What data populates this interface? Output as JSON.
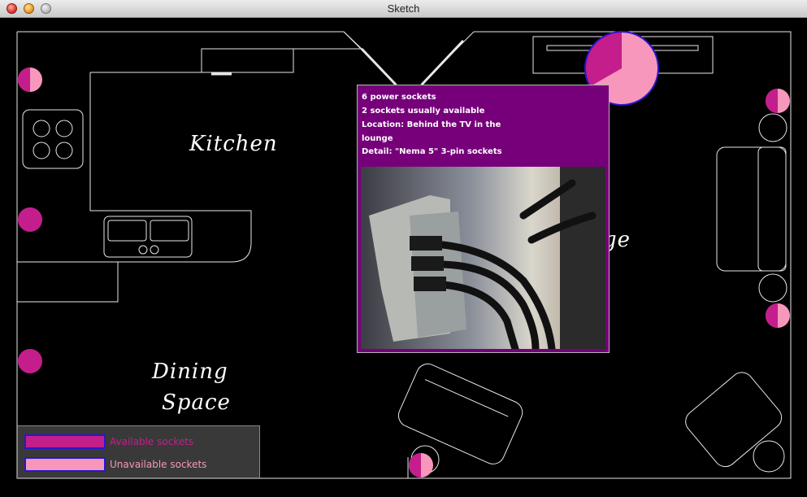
{
  "window": {
    "title": "Sketch"
  },
  "rooms": {
    "kitchen": "Kitchen",
    "dining_line1": "Dining",
    "dining_line2": "Space",
    "lounge_partial": "ge"
  },
  "popup": {
    "line1": "6 power sockets",
    "line2": "2 sockets usually available",
    "line3": "Location: Behind the TV in the",
    "line4": "lounge",
    "line5": "Detail: \"Nema 5\" 3-pin sockets",
    "photo_icon": "power-strip-photo"
  },
  "legend": {
    "available_label": "Available sockets",
    "unavailable_label": "Unavailable sockets"
  },
  "colors": {
    "available": "#c41e8c",
    "unavailable": "#f797bc",
    "popup_bg": "#76007a",
    "outline": "#2a16cc"
  },
  "sockets": [
    {
      "name": "socket-lounge-tv",
      "available_fraction": 0.333
    },
    {
      "name": "socket-kitchen-left",
      "available_fraction": 0.5
    },
    {
      "name": "socket-right-top",
      "available_fraction": 0.5
    },
    {
      "name": "socket-right-mid",
      "available_fraction": 0.5
    },
    {
      "name": "socket-bottom",
      "available_fraction": 0.5
    },
    {
      "name": "socket-left-mid",
      "available_fraction": 1
    },
    {
      "name": "socket-left-lower",
      "available_fraction": 1
    }
  ]
}
